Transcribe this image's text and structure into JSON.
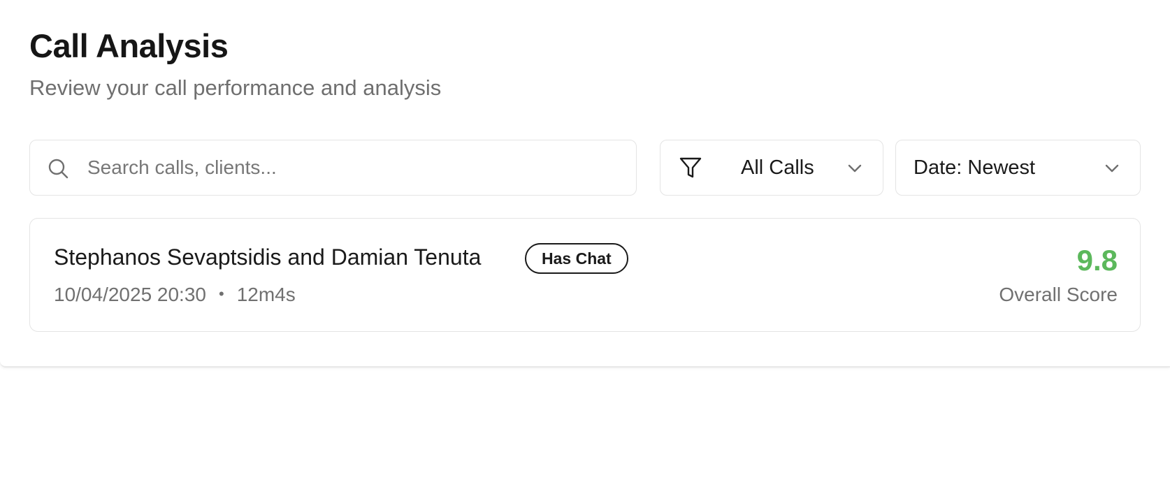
{
  "header": {
    "title": "Call Analysis",
    "subtitle": "Review your call performance and analysis"
  },
  "search": {
    "placeholder": "Search calls, clients...",
    "value": "",
    "icon": "search-icon"
  },
  "filter": {
    "icon": "filter-icon",
    "selected": "All Calls"
  },
  "sort": {
    "selected": "Date: Newest"
  },
  "calls": [
    {
      "name": "Stephanos Sevaptsidis and Damian Tenuta",
      "badge": "Has Chat",
      "datetime": "10/04/2025 20:30",
      "separator": "•",
      "duration": "12m4s",
      "score": "9.8",
      "score_label": "Overall Score",
      "score_color": "#5cb85c"
    }
  ]
}
